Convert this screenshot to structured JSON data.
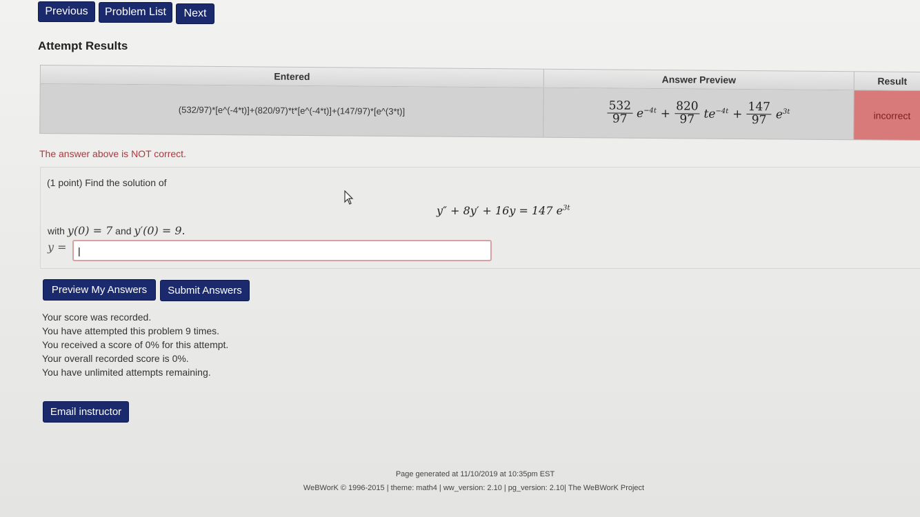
{
  "nav": {
    "previous": "Previous",
    "problem_list": "Problem List",
    "next": "Next"
  },
  "attempt_results": {
    "heading": "Attempt Results",
    "headers": {
      "entered": "Entered",
      "answer_preview": "Answer Preview",
      "result": "Result"
    },
    "entered": "(532/97)*[e^(-4*t)]+(820/97)*t*[e^(-4*t)]+(147/97)*[e^(3*t)]",
    "preview": {
      "term1_num": "532",
      "term1_den": "97",
      "term1_var": "e",
      "term1_exp": "−4t",
      "plus1": "+",
      "term2_num": "820",
      "term2_den": "97",
      "term2_var": "te",
      "term2_exp": "−4t",
      "plus2": "+",
      "term3_num": "147",
      "term3_den": "97",
      "term3_var": "e",
      "term3_exp": "3t"
    },
    "result": "incorrect",
    "message": "The answer above is NOT correct."
  },
  "problem": {
    "intro": "(1 point) Find the solution of",
    "equation": "y″ + 8y′ + 16y = 147 e",
    "equation_exp": "3t",
    "cond_prefix": "with ",
    "cond_1": "y(0) = 7",
    "cond_and": " and ",
    "cond_2": "y′(0) = 9",
    "cond_suffix": ".",
    "answer_label": "y =",
    "answer_value": "|"
  },
  "actions": {
    "preview": "Preview My Answers",
    "submit": "Submit Answers",
    "email": "Email instructor"
  },
  "status": {
    "recorded": "Your score was recorded.",
    "attempts": "You have attempted this problem 9 times.",
    "score_attempt": "You received a score of 0% for this attempt.",
    "overall": "Your overall recorded score is 0%.",
    "remaining": "You have unlimited attempts remaining."
  },
  "footer": {
    "generated": "Page generated at 11/10/2019 at 10:35pm EST",
    "credits": "WeBWorK © 1996-2015 | theme: math4 | ww_version: 2.10 | pg_version: 2.10| The WeBWorK Project"
  },
  "colors": {
    "button_bg": "#1a2a6c",
    "incorrect_bg": "#d87a7a",
    "error_text": "#b0363d"
  }
}
